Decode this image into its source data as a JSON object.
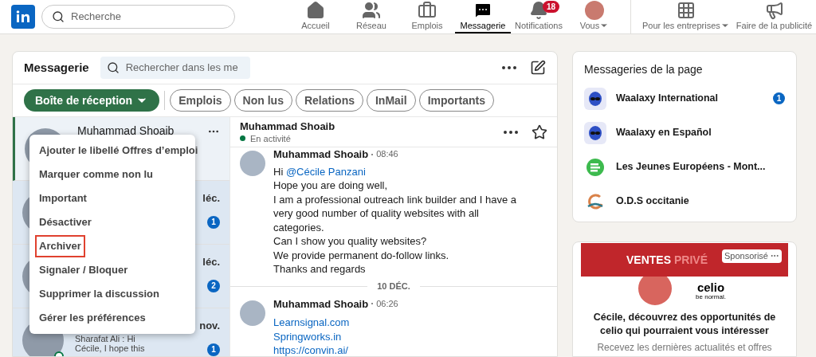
{
  "nav": {
    "search_placeholder": "Recherche",
    "items": [
      {
        "kind": "home",
        "label": "Accueil",
        "selected": false
      },
      {
        "kind": "network",
        "label": "Réseau",
        "selected": false
      },
      {
        "kind": "jobs",
        "label": "Emplois",
        "selected": false
      },
      {
        "kind": "messaging",
        "label": "Messagerie",
        "selected": true
      },
      {
        "kind": "bell",
        "label": "Notifications",
        "selected": false,
        "badge": "18"
      },
      {
        "kind": "avatar",
        "label": "Vous",
        "selected": false,
        "caret": true
      },
      {
        "kind": "grid",
        "label": "Pour les entreprises",
        "selected": false,
        "caret": true
      },
      {
        "kind": "ads",
        "label": "Faire de la publicité",
        "selected": false
      }
    ]
  },
  "messaging": {
    "title": "Messagerie",
    "search_placeholder": "Rechercher dans les me",
    "filters": [
      {
        "label": "Boîte de réception",
        "selected": true
      },
      {
        "label": "Emplois",
        "selected": false
      },
      {
        "label": "Non lus",
        "selected": false
      },
      {
        "label": "Relations",
        "selected": false
      },
      {
        "label": "InMail",
        "selected": false
      },
      {
        "label": "Importants",
        "selected": false
      }
    ],
    "conversations": [
      {
        "name": "Muhammad Shoaib",
        "selected": true,
        "unread": false
      },
      {
        "date": "léc.",
        "badge": "1",
        "selected": false,
        "unread": true
      },
      {
        "date": "léc.",
        "badge": "2",
        "selected": false,
        "unread": true
      },
      {
        "date": "nov.",
        "badge": "1",
        "preview": [
          "Sharafat Ali : Hi",
          "Cécile, I hope this"
        ],
        "online": true,
        "selected": false,
        "unread": true
      }
    ],
    "context_menu": [
      {
        "label": "Ajouter le libellé Offres d’emploi",
        "outlined": false
      },
      {
        "label": "Marquer comme non lu",
        "outlined": false
      },
      {
        "label": "Important",
        "outlined": false
      },
      {
        "label": "Désactiver",
        "outlined": false
      },
      {
        "label": "Archiver",
        "outlined": true
      },
      {
        "label": "Signaler / Bloquer",
        "outlined": false
      },
      {
        "label": "Supprimer la discussion",
        "outlined": false
      },
      {
        "label": "Gérer les préférences",
        "outlined": false
      }
    ],
    "thread": {
      "name": "Muhammad Shoaib",
      "status": "En activité",
      "online": true,
      "starred": false,
      "messages": [
        {
          "sender": "Muhammad Shoaib",
          "time": "08:46",
          "greeting": "Hi",
          "mention": "@Cécile Panzani",
          "lines": [
            "Hope you are doing well,",
            "I am a professional outreach link builder and I have a very good number of quality websites with all categories.",
            "Can I show you quality websites?",
            "We provide permanent do-follow links.",
            "Thanks and regards"
          ]
        },
        {
          "date_separator": "10 DÉC.",
          "sender": "Muhammad Shoaib",
          "time": "06:26",
          "links": [
            "Learnsignal.com",
            "Springworks.in",
            "https://convin.ai/"
          ]
        }
      ]
    }
  },
  "pages": {
    "title": "Messageries de la page",
    "items": [
      {
        "kind": "alien",
        "name": "Waalaxy International",
        "badge": "1"
      },
      {
        "kind": "alien",
        "name": "Waalaxy en Español"
      },
      {
        "kind": "bars",
        "name": "Les Jeunes Européens - Mont..."
      },
      {
        "kind": "arc",
        "name": "O.D.S occitanie"
      }
    ]
  },
  "ad": {
    "banner_word1": "VENTES",
    "banner_word2": "PRIVÉ",
    "sponsored": "Sponsorisé",
    "brand": "celio",
    "tagline": "be normal.",
    "headline": "Cécile, découvrez des opportunités de celio qui pourraient vous intéresser",
    "text": "Recevez les dernières actualités et offres"
  }
}
